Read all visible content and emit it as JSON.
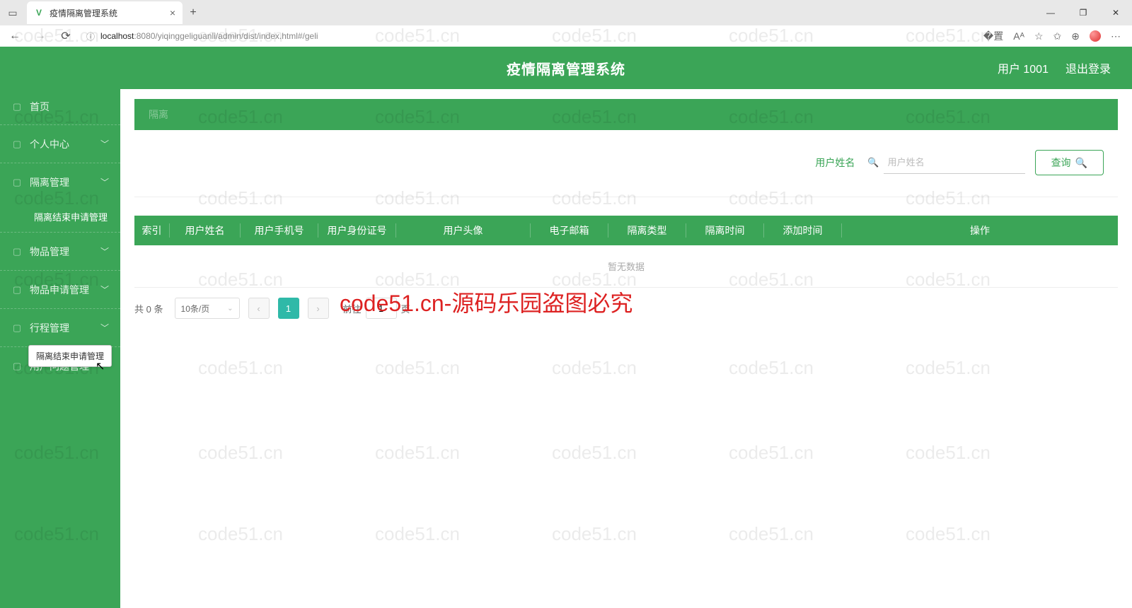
{
  "browser": {
    "tab_title": "疫情隔离管理系统",
    "url_host": "localhost",
    "url_port": ":8080",
    "url_path": "/yiqinggeliguanli/admin/dist/index.html#/geli"
  },
  "header": {
    "title": "疫情隔离管理系统",
    "user": "用户 1001",
    "logout": "退出登录"
  },
  "sidebar": {
    "items": [
      {
        "label": "首页",
        "expandable": false
      },
      {
        "label": "个人中心",
        "expandable": true
      },
      {
        "label": "隔离管理",
        "expandable": true
      },
      {
        "label": "隔离结束申请管理",
        "expandable": false,
        "sub": true
      },
      {
        "label": "物品管理",
        "expandable": true
      },
      {
        "label": "物品申请管理",
        "expandable": true
      },
      {
        "label": "行程管理",
        "expandable": true
      },
      {
        "label": "用户问题管理",
        "expandable": true
      }
    ],
    "tooltip": "隔离结束申请管理"
  },
  "crumb": "隔离",
  "filter": {
    "label": "用户姓名",
    "placeholder": "用户姓名",
    "query_btn": "查询"
  },
  "table": {
    "columns": [
      "索引",
      "用户姓名",
      "用户手机号",
      "用户身份证号",
      "用户头像",
      "电子邮箱",
      "隔离类型",
      "隔离时间",
      "添加时间",
      "操作"
    ],
    "widths": [
      50,
      100,
      110,
      110,
      190,
      110,
      110,
      110,
      110,
      260
    ],
    "empty": "暂无数据"
  },
  "pagination": {
    "total_prefix": "共",
    "total_count": "0",
    "total_suffix": "条",
    "page_size": "10条/页",
    "current": "1",
    "jump_prefix": "前往",
    "jump_value": "1",
    "jump_suffix": "页"
  },
  "watermark_text": "code51.cn",
  "big_watermark": "code51.cn-源码乐园盗图必究"
}
